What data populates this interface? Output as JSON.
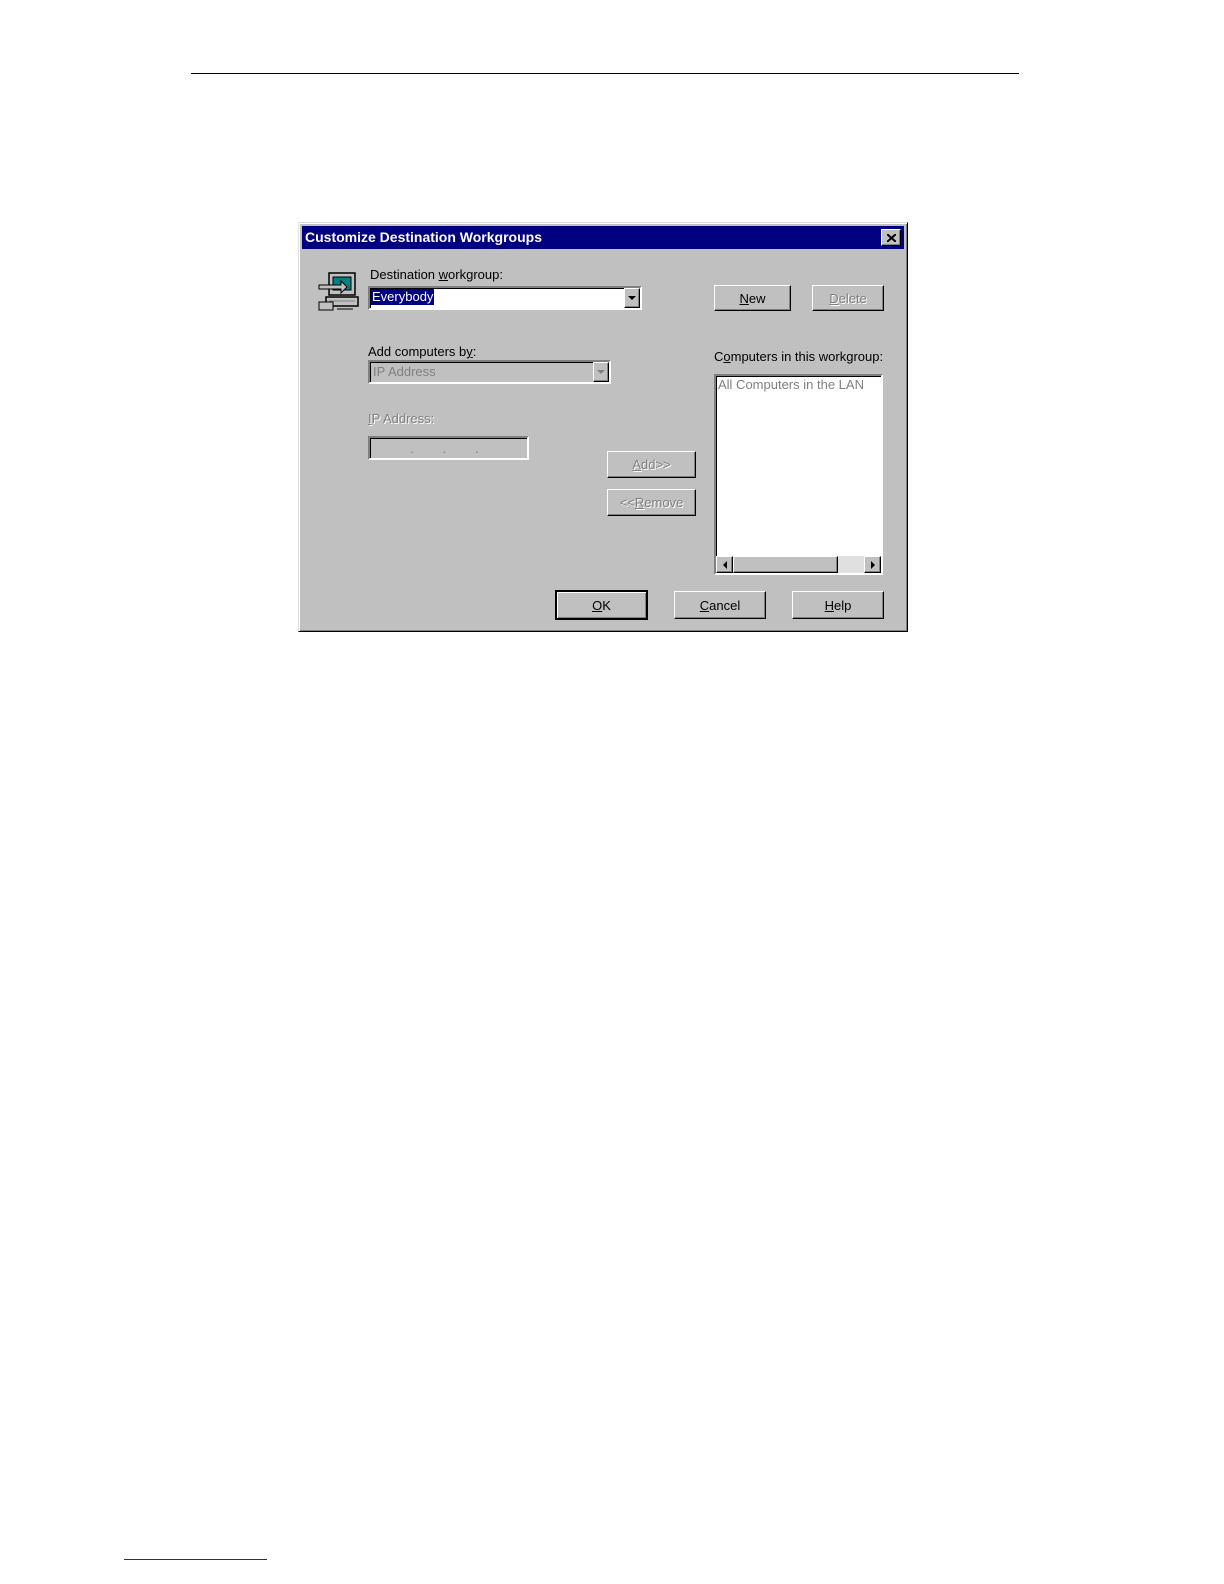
{
  "dialog": {
    "title": "Customize Destination Workgroups",
    "destination_workgroup_label_pre": "Destination ",
    "destination_workgroup_label_key": "w",
    "destination_workgroup_label_post": "orkgroup:",
    "destination_workgroup_value": "Everybody",
    "new_button": {
      "key": "N",
      "rest": "ew"
    },
    "delete_button": {
      "key": "D",
      "rest": "elete"
    },
    "add_computers_by_label_pre": "Add computers b",
    "add_computers_by_label_key": "y",
    "add_computers_by_label_post": ":",
    "add_computers_by_value": "IP Address",
    "ip_address_label_key": "I",
    "ip_address_label_rest": "P Address:",
    "ip_address_dots": ".        .        .",
    "add_button": {
      "key": "A",
      "rest": "dd>>"
    },
    "remove_button": {
      "pre": "<<",
      "key": "R",
      "rest": "emove"
    },
    "computers_label_pre": "C",
    "computers_label_key": "o",
    "computers_label_post": "mputers in this workgroup:",
    "computers_list": [
      "All Computers in the LAN"
    ],
    "ok_button": {
      "key": "O",
      "rest": "K"
    },
    "cancel_button": {
      "key": "C",
      "rest": "ancel"
    },
    "help_button": {
      "key": "H",
      "rest": "elp"
    }
  },
  "colors": {
    "titlebar": "#000080",
    "face": "#c0c0c0",
    "disabled_text": "#808080"
  },
  "icons": [
    "network-computer-icon",
    "close-icon",
    "dropdown-arrow-icon",
    "scroll-left-icon",
    "scroll-right-icon"
  ]
}
